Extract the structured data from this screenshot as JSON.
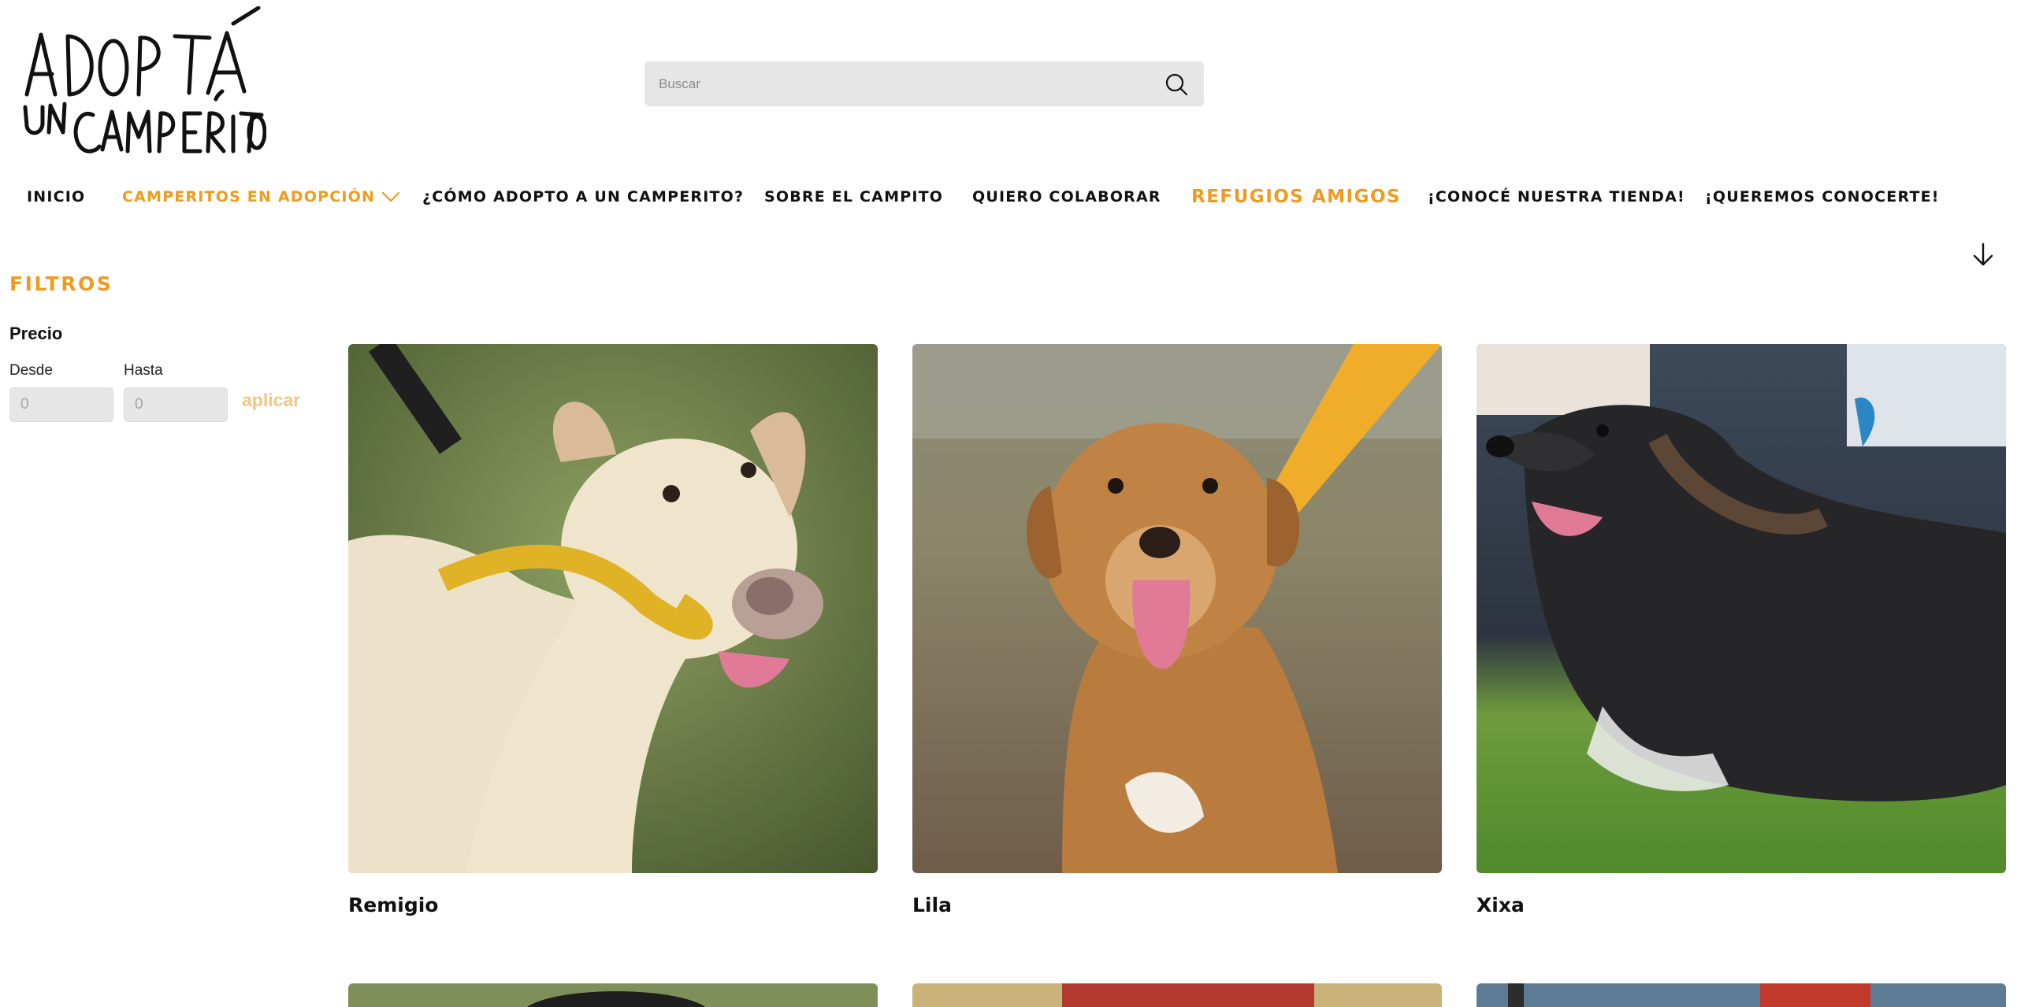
{
  "logo": {
    "line1": "ADOPTÁ",
    "line2": "UN CAMPERITO"
  },
  "search": {
    "placeholder": "Buscar"
  },
  "nav": {
    "items": [
      {
        "label": "INICIO"
      },
      {
        "label": "CAMPERITOS EN ADOPCIÓN"
      },
      {
        "label": "¿CÓMO ADOPTO A UN CAMPERITO?"
      },
      {
        "label": "SOBRE EL CAMPITO"
      },
      {
        "label": "QUIERO COLABORAR"
      },
      {
        "label": "REFUGIOS AMIGOS"
      },
      {
        "label": "¡CONOCÉ NUESTRA TIENDA!"
      },
      {
        "label": "¡QUEREMOS CONOCERTE!"
      }
    ]
  },
  "filters": {
    "title": "FILTROS",
    "price_label": "Precio",
    "from_label": "Desde",
    "to_label": "Hasta",
    "from_placeholder": "0",
    "to_placeholder": "0",
    "apply_label": "aplicar"
  },
  "products": [
    {
      "name": "Remigio"
    },
    {
      "name": "Lila"
    },
    {
      "name": "Xixa"
    }
  ],
  "colors": {
    "accent": "#f09a1e",
    "apply": "#f4c684",
    "search_bg": "#e6e6e6"
  },
  "icons": {
    "search": "search-icon",
    "nav_chevron": "chevron-down-icon",
    "scroll": "arrow-down-icon"
  }
}
